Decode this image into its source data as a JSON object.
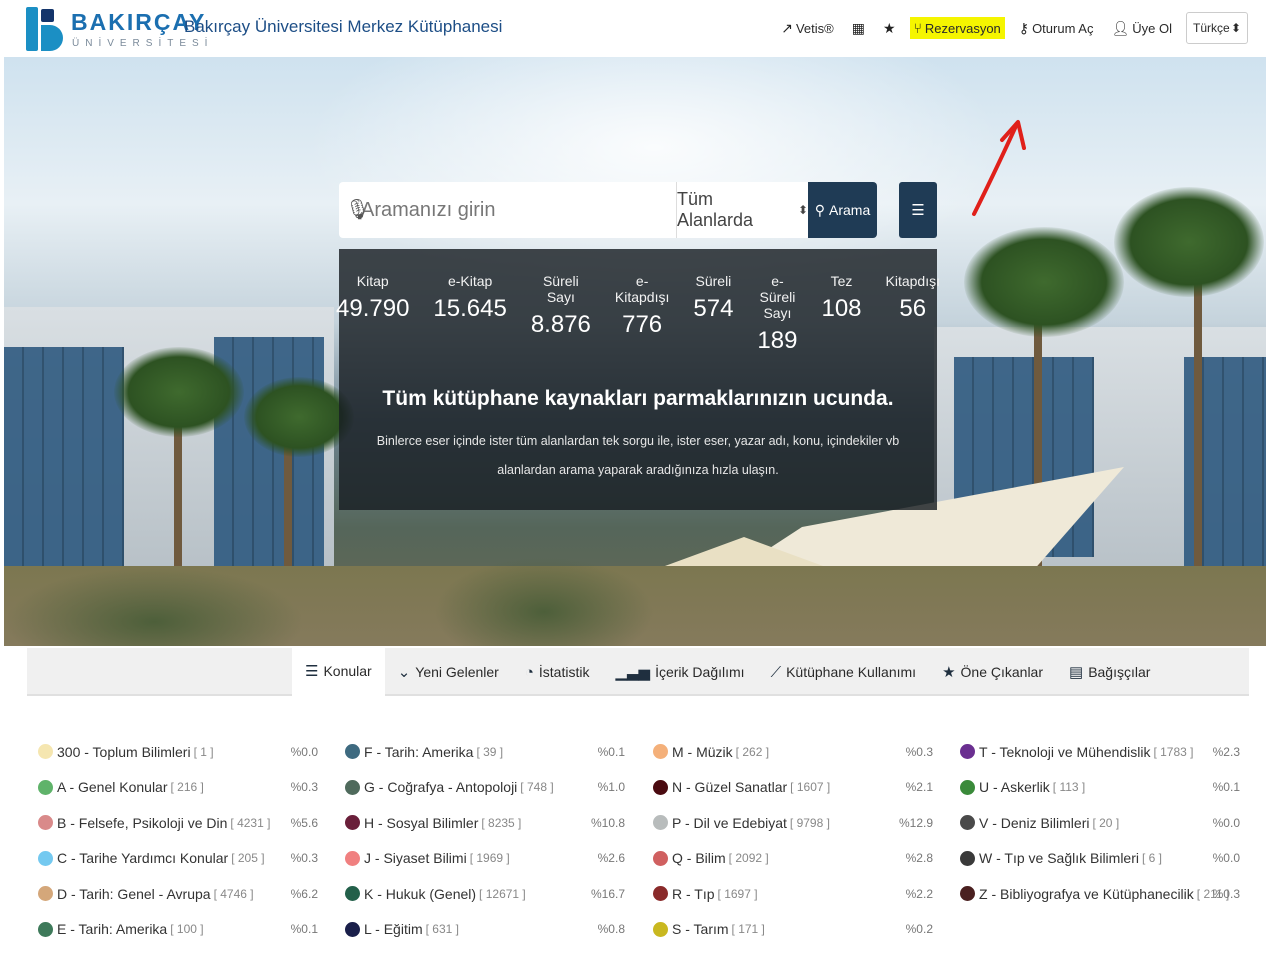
{
  "brand": {
    "name": "BAKIRÇAY",
    "sub": "ÜNİVERSİTESİ",
    "title": "Bakırçay Üniversitesi Merkez Kütüphanesi"
  },
  "nav": {
    "vetis": "Vetis®",
    "rezervasyon": "Rezervasyon",
    "oturum": "Oturum Aç",
    "uye": "Üye Ol",
    "language": "Türkçe"
  },
  "search": {
    "placeholder": "Aramanızı girin",
    "scope": "Tüm Alanlarda",
    "button": "Arama"
  },
  "stats": [
    {
      "label": "Kitap",
      "value": "49.790"
    },
    {
      "label": "e-Kitap",
      "value": "15.645"
    },
    {
      "label": "Süreli Sayı",
      "value": "8.876"
    },
    {
      "label": "e-Kitapdışı",
      "value": "776"
    },
    {
      "label": "Süreli",
      "value": "574"
    },
    {
      "label": "e-Süreli Sayı",
      "value": "189"
    },
    {
      "label": "Tez",
      "value": "108"
    },
    {
      "label": "Kitapdışı",
      "value": "56"
    }
  ],
  "hero": {
    "tagline": "Tüm kütüphane kaynakları parmaklarınızın ucunda.",
    "description": "Binlerce eser içinde ister tüm alanlardan tek sorgu ile, ister eser, yazar adı, konu, içindekiler vb alanlardan arama yaparak aradığınıza hızla ulaşın."
  },
  "tabs": [
    "Konular",
    "Yeni Gelenler",
    "İstatistik",
    "İçerik Dağılımı",
    "Kütüphane Kullanımı",
    "Öne Çıkanlar",
    "Bağışçılar"
  ],
  "subjects": [
    [
      {
        "label": "300 - Toplum Bilimleri",
        "count": "[ 1 ]",
        "pct": "%0.0",
        "color": "#f5e6b0"
      },
      {
        "label": "A - Genel Konular",
        "count": "[ 216 ]",
        "pct": "%0.3",
        "color": "#5fb36a"
      },
      {
        "label": "B - Felsefe, Psikoloji ve Din",
        "count": "[ 4231 ]",
        "pct": "%5.6",
        "color": "#d98a8a"
      },
      {
        "label": "C - Tarihe Yardımcı Konular",
        "count": "[ 205 ]",
        "pct": "%0.3",
        "color": "#74c9f0"
      },
      {
        "label": "D - Tarih: Genel - Avrupa",
        "count": "[ 4746 ]",
        "pct": "%6.2",
        "color": "#d4a77a"
      },
      {
        "label": "E - Tarih: Amerika",
        "count": "[ 100 ]",
        "pct": "%0.1",
        "color": "#3e7a5a"
      }
    ],
    [
      {
        "label": "F - Tarih: Amerika",
        "count": "[ 39 ]",
        "pct": "%0.1",
        "color": "#3e6a80"
      },
      {
        "label": "G - Coğrafya - Antopoloji",
        "count": "[ 748 ]",
        "pct": "%1.0",
        "color": "#4f6a5c"
      },
      {
        "label": "H - Sosyal Bilimler",
        "count": "[ 8235 ]",
        "pct": "%10.8",
        "color": "#6a1f3a"
      },
      {
        "label": "J - Siyaset Bilimi",
        "count": "[ 1969 ]",
        "pct": "%2.6",
        "color": "#f08080"
      },
      {
        "label": "K - Hukuk (Genel)",
        "count": "[ 12671 ]",
        "pct": "%16.7",
        "color": "#23604a"
      },
      {
        "label": "L - Eğitim",
        "count": "[ 631 ]",
        "pct": "%0.8",
        "color": "#1a1f4a"
      }
    ],
    [
      {
        "label": "M - Müzik",
        "count": "[ 262 ]",
        "pct": "%0.3",
        "color": "#f4b07a"
      },
      {
        "label": "N - Güzel Sanatlar",
        "count": "[ 1607 ]",
        "pct": "%2.1",
        "color": "#4a0a10"
      },
      {
        "label": "P - Dil ve Edebiyat",
        "count": "[ 9798 ]",
        "pct": "%12.9",
        "color": "#b8bcbc"
      },
      {
        "label": "Q - Bilim",
        "count": "[ 2092 ]",
        "pct": "%2.8",
        "color": "#d06060"
      },
      {
        "label": "R - Tıp",
        "count": "[ 1697 ]",
        "pct": "%2.2",
        "color": "#8a2a2a"
      },
      {
        "label": "S - Tarım",
        "count": "[ 171 ]",
        "pct": "%0.2",
        "color": "#c9b820"
      }
    ],
    [
      {
        "label": "T - Teknoloji ve Mühendislik",
        "count": "[ 1783 ]",
        "pct": "%2.3",
        "color": "#6a2f90"
      },
      {
        "label": "U - Askerlik",
        "count": "[ 113 ]",
        "pct": "%0.1",
        "color": "#3a8a3a"
      },
      {
        "label": "V - Deniz Bilimleri",
        "count": "[ 20 ]",
        "pct": "%0.0",
        "color": "#4a4a4a"
      },
      {
        "label": "W - Tıp ve Sağlık Bilimleri",
        "count": "[ 6 ]",
        "pct": "%0.0",
        "color": "#3a3a3a"
      },
      {
        "label": "Z - Bibliyografya ve Kütüphanecilik",
        "count": "[ 211 ]",
        "pct": "%0.3",
        "color": "#4a2020"
      }
    ]
  ]
}
